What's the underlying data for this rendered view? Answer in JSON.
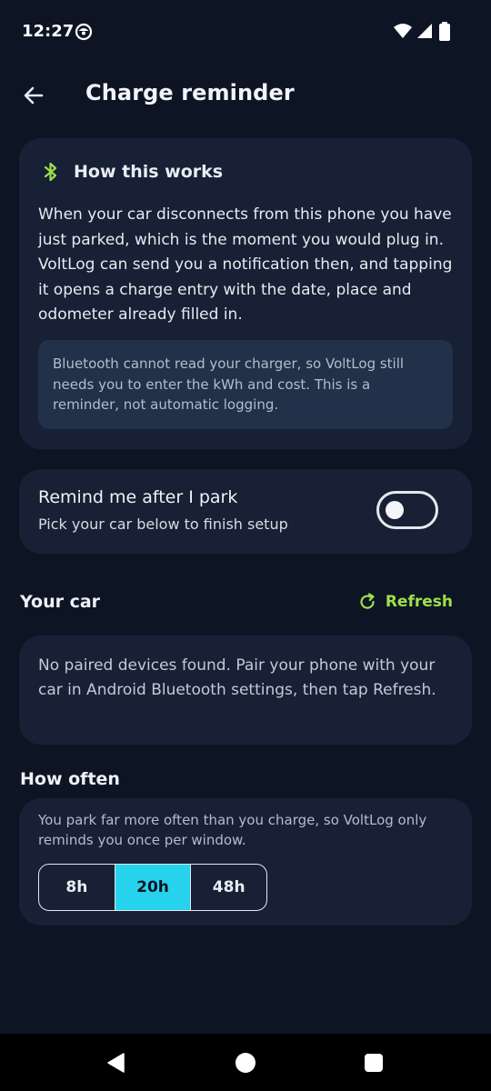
{
  "status_bar": {
    "time": "12:27",
    "icons": [
      "app-notification-icon",
      "wifi-icon",
      "cell-signal-icon",
      "battery-icon"
    ]
  },
  "top_bar": {
    "title": "Charge reminder",
    "back_icon": "arrow-left-icon"
  },
  "info_card": {
    "icon": "bluetooth-icon",
    "title": "How this works",
    "body": "When your car disconnects from this phone you have just parked, which is the moment you would plug in. VoltLog can send you a notification then, and tapping it opens a charge entry with the date, place and odometer already filled in.",
    "note": "Bluetooth cannot read your charger, so VoltLog still needs you to enter the kWh and cost. This is a reminder, not automatic logging."
  },
  "remind_card": {
    "title": "Remind me after I park",
    "subtitle": "Pick your car below to finish setup",
    "enabled": false
  },
  "your_car": {
    "title": "Your car",
    "refresh_label": "Refresh",
    "refresh_icon": "refresh-icon",
    "empty_text": "No paired devices found. Pair your phone with your car in Android Bluetooth settings, then tap Refresh."
  },
  "how_often": {
    "title": "How often",
    "description": "You park far more often than you charge, so VoltLog only reminds you once per window.",
    "options": [
      {
        "label": "8h",
        "selected": false
      },
      {
        "label": "20h",
        "selected": true
      },
      {
        "label": "48h",
        "selected": false
      }
    ]
  },
  "nav_bar": {
    "icons": [
      "nav-back-icon",
      "nav-home-icon",
      "nav-recents-icon"
    ]
  },
  "colors": {
    "background": "#0d1525",
    "card": "#172034",
    "accent_green": "#9ee04a",
    "accent_cyan": "#27d3ec"
  }
}
